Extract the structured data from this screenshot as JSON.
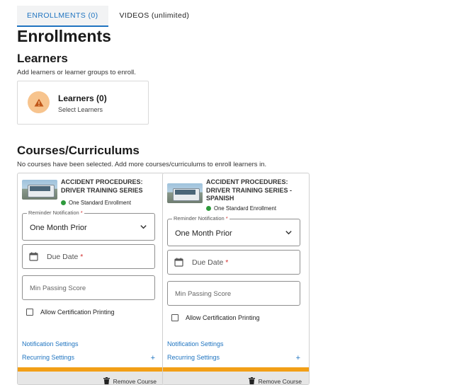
{
  "tabs": [
    {
      "label": "ENROLLMENTS (0)",
      "active": true
    },
    {
      "label": "VIDEOS (unlimited)",
      "active": false
    }
  ],
  "page_title": "Enrollments",
  "learners": {
    "heading": "Learners",
    "description": "Add learners or learner groups to enroll.",
    "card_title": "Learners (0)",
    "card_sub": "Select Learners",
    "icon": "warning-icon"
  },
  "courses": {
    "heading": "Courses/Curriculums",
    "description": "No courses have been selected. Add more courses/curriculums to enroll learners in.",
    "items": [
      {
        "title": "ACCIDENT PROCEDURES: DRIVER TRAINING SERIES",
        "enrollment_type": "One Standard Enrollment",
        "reminder_label": "Reminder Notification",
        "reminder_value": "One Month Prior",
        "due_date_label": "Due Date",
        "min_score_placeholder": "Min Passing Score",
        "cert_label": "Allow Certification Printing",
        "notification_link": "Notification Settings",
        "recurring_link": "Recurring Settings",
        "plus": "+",
        "remove_label": "Remove Course"
      },
      {
        "title": "ACCIDENT PROCEDURES: DRIVER TRAINING SERIES - SPANISH",
        "enrollment_type": "One Standard Enrollment",
        "reminder_label": "Reminder Notification",
        "reminder_value": "One Month Prior",
        "due_date_label": "Due Date",
        "min_score_placeholder": "Min Passing Score",
        "cert_label": "Allow Certification Printing",
        "notification_link": "Notification Settings",
        "recurring_link": "Recurring Settings",
        "plus": "+",
        "remove_label": "Remove Course"
      }
    ]
  },
  "required_marker": "*",
  "colors": {
    "accent": "#1f74c0",
    "warning_bg": "#f7c48e",
    "warning_icon": "#c0571a",
    "enrollment_dot": "#2e9a3c",
    "card_stripe": "#f29f16",
    "required": "#d32f2f"
  }
}
